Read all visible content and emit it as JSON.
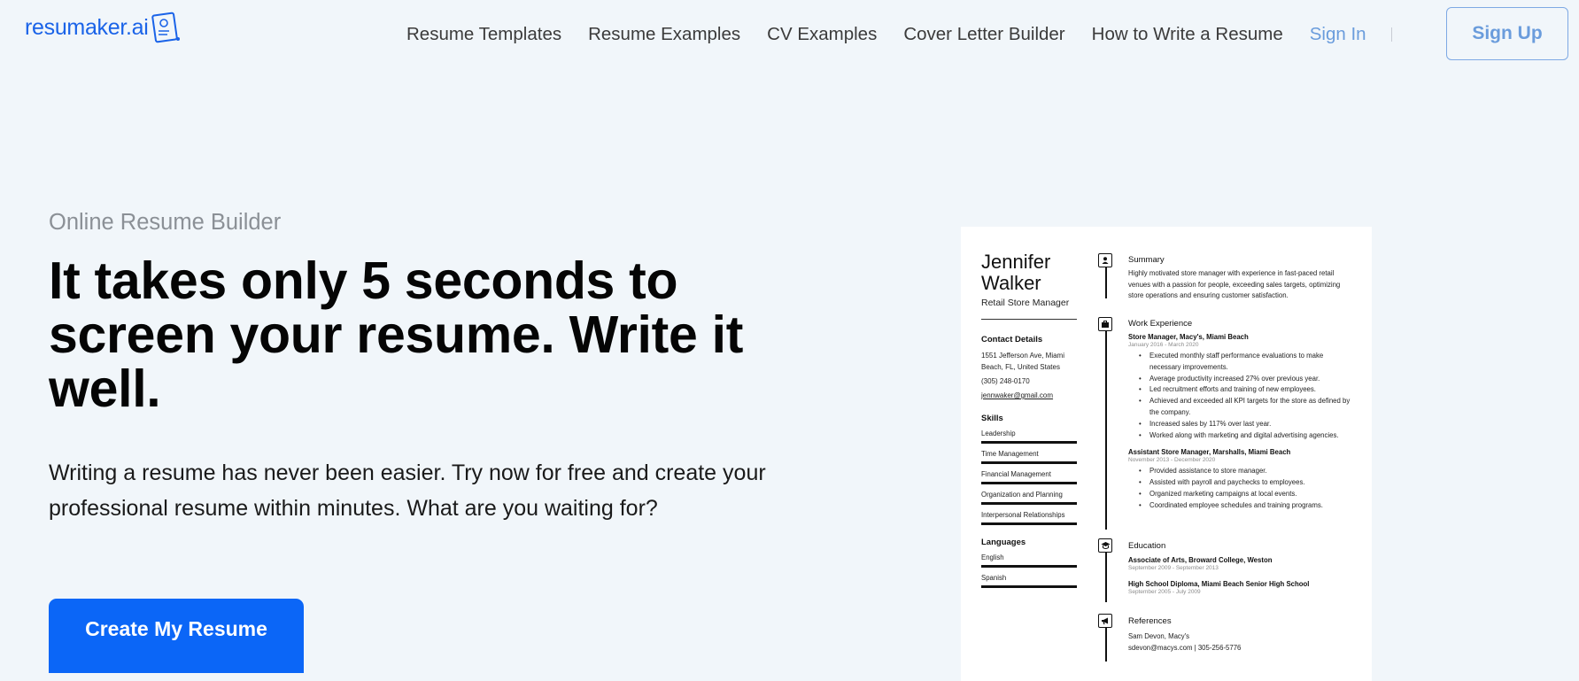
{
  "header": {
    "logo_text": "resumaker.ai",
    "nav": [
      "Resume Templates",
      "Resume Examples",
      "CV Examples",
      "Cover Letter Builder",
      "How to Write a Resume"
    ],
    "sign_in": "Sign In",
    "sign_up": "Sign Up"
  },
  "hero": {
    "eyebrow": "Online Resume Builder",
    "headline": "It takes only 5 seconds to screen your resume. Write it well.",
    "subtitle": "Writing a resume has never been easier. Try now for free and create your professional resume within minutes. What are you waiting for?",
    "cta": "Create My Resume"
  },
  "resume": {
    "first_name": "Jennifer",
    "last_name": "Walker",
    "job_title": "Retail Store Manager",
    "contact_heading": "Contact Details",
    "address": "1551 Jefferson Ave, Miami Beach, FL, United States",
    "phone": "(305) 248-0170",
    "email": "jennwaker@gmail.com",
    "skills_heading": "Skills",
    "skills": [
      "Leadership",
      "Time Management",
      "Financial Management",
      "Organization and Planning",
      "Interpersonal Relationships"
    ],
    "languages_heading": "Languages",
    "languages": [
      "English",
      "Spanish"
    ],
    "summary_heading": "Summary",
    "summary": "Highly motivated store manager with experience in fast-paced retail venues with a passion for people, exceeding sales targets, optimizing store operations and ensuring customer satisfaction.",
    "work_heading": "Work Experience",
    "jobs": [
      {
        "title": "Store Manager, Macy's, Miami Beach",
        "dates": "January 2016 - March 2020",
        "bullets": [
          "Executed monthly staff performance evaluations to make necessary improvements.",
          "Average productivity increased 27% over previous year.",
          "Led recruitment efforts and training of new employees.",
          "Achieved and exceeded all KPI targets for the store as defined by the company.",
          "Increased sales by 117% over last year.",
          "Worked along with marketing and digital advertising agencies."
        ]
      },
      {
        "title": "Assistant Store Manager, Marshalls, Miami Beach",
        "dates": "November 2013 - December 2020",
        "bullets": [
          "Provided assistance to store manager.",
          "Assisted with payroll and paychecks to employees.",
          "Organized marketing campaigns at local events.",
          "Coordinated employee schedules and training programs."
        ]
      }
    ],
    "education_heading": "Education",
    "education": [
      {
        "title": "Associate of Arts, Broward College, Weston",
        "dates": "September 2009 - September 2013"
      },
      {
        "title": "High School Diploma, Miami Beach Senior High School",
        "dates": "September 2005 - July 2009"
      }
    ],
    "references_heading": "References",
    "reference_name": "Sam Devon, Macy's",
    "reference_contact": "sdevon@macys.com | 305-256-5776"
  },
  "colors": {
    "brand": "#1a63e8",
    "cta": "#0b66f7",
    "background": "#f1f6fa",
    "link_muted": "#6a9cdc"
  },
  "icons": [
    "resume-logo-icon",
    "person-icon",
    "briefcase-icon",
    "graduation-cap-icon",
    "megaphone-icon"
  ]
}
